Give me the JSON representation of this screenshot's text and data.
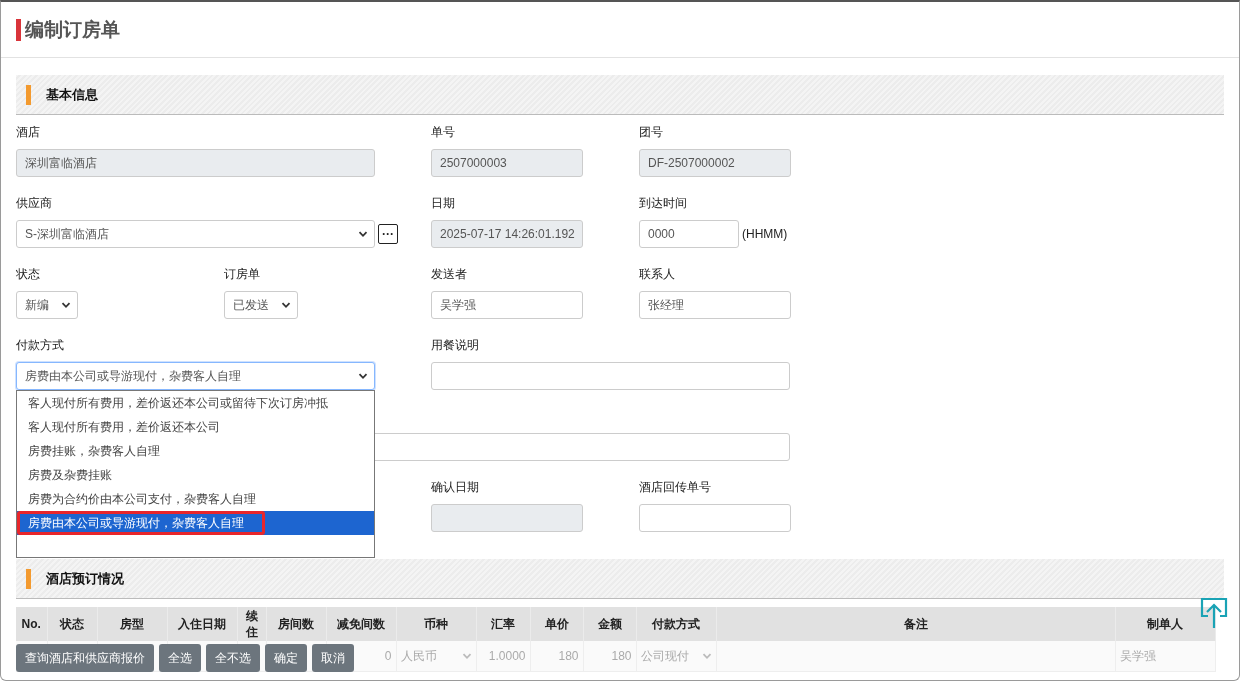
{
  "page_title": "编制订房单",
  "sections": [
    {
      "title": "基本信息"
    },
    {
      "title": "酒店预订情况"
    }
  ],
  "form_rows": [
    [
      {
        "label": "酒店",
        "value": "深圳富临酒店",
        "kind": "wide-readonly"
      },
      {
        "label": "单号",
        "value": "2507000003",
        "kind": "readonly"
      },
      {
        "label": "团号",
        "value": "DF-2507000002",
        "kind": "readonly"
      }
    ],
    [
      {
        "label": "供应商",
        "value": "S-深圳富临酒店",
        "kind": "wide-select-more",
        "button": "···"
      },
      {
        "label": "日期",
        "value": "2025-07-17 14:26:01.192",
        "kind": "readonly"
      },
      {
        "label": "到达时间",
        "value": "0000",
        "kind": "short-input",
        "suffix": "(HHMM)"
      }
    ],
    [
      {
        "label": "状态",
        "value": "新编",
        "kind": "small-select"
      },
      {
        "label": "订房单",
        "value": "已发送",
        "kind": "small-select"
      },
      {
        "label": "发送者",
        "value": "吴学强",
        "kind": "input"
      },
      {
        "label": "联系人",
        "value": "张经理",
        "kind": "input"
      }
    ],
    [
      {
        "label": "付款方式",
        "value": "房费由本公司或导游现付，杂费客人自理",
        "kind": "wide-dropdown"
      },
      {
        "label": "用餐说明",
        "kind": "wide-input"
      }
    ],
    [
      {
        "kind": "full-input"
      }
    ],
    [
      {
        "kind": "blank"
      },
      {
        "label": "确认日期",
        "kind": "readonly"
      },
      {
        "label": "酒店回传单号",
        "kind": "input"
      }
    ]
  ],
  "payment_options": [
    {
      "label": "客人现付所有费用，差价返还本公司或留待下次订房冲抵",
      "selected": false
    },
    {
      "label": "客人现付所有费用，差价返还本公司",
      "selected": false
    },
    {
      "label": "房费挂账，杂费客人自理",
      "selected": false
    },
    {
      "label": "房费及杂费挂账",
      "selected": false
    },
    {
      "label": "房费为合约价由本公司支付，杂费客人自理",
      "selected": false
    },
    {
      "label": "房费由本公司或导游现付，杂费客人自理",
      "selected": true
    }
  ],
  "table": {
    "columns": [
      {
        "label": "No."
      },
      {
        "label": "状态"
      },
      {
        "label": "房型"
      },
      {
        "label": "入住日期"
      },
      {
        "label": "续住"
      },
      {
        "label": "房间数"
      },
      {
        "label": "减免间数",
        "cell": {
          "kind": "number",
          "value": "0"
        }
      },
      {
        "label": "币种",
        "cell": {
          "kind": "select",
          "value": "人民币"
        }
      },
      {
        "label": "汇率",
        "cell": {
          "kind": "number",
          "value": "1.0000"
        }
      },
      {
        "label": "单价",
        "cell": {
          "kind": "number",
          "value": "180"
        }
      },
      {
        "label": "金额",
        "cell": {
          "kind": "number",
          "value": "180"
        }
      },
      {
        "label": "付款方式",
        "cell": {
          "kind": "select",
          "value": "公司现付"
        }
      },
      {
        "label": "备注"
      },
      {
        "label": "制单人",
        "cell": {
          "kind": "text",
          "value": "吴学强"
        }
      }
    ]
  },
  "buttons": [
    "查询酒店和供应商报价",
    "全选",
    "全不选",
    "确定",
    "取消"
  ]
}
